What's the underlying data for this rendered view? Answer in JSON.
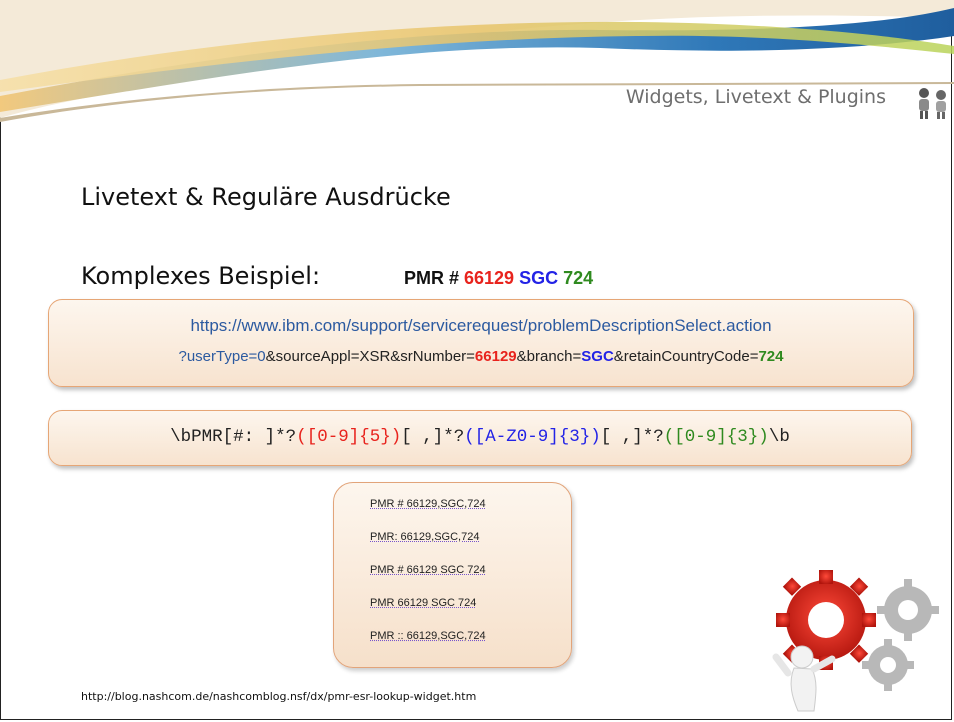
{
  "header": {
    "title": "Widgets, Livetext & Plugins",
    "icon": "people-icon"
  },
  "heading": "Livetext & Reguläre Ausdrücke",
  "subheading": "Komplexes Beispiel:",
  "pmr_example": {
    "p1": "PMR # ",
    "p2": "66129",
    "p3": " SGC",
    "p4": " 724"
  },
  "url": {
    "line1": "https://www.ibm.com/support/servicerequest/problemDescriptionSelect.action",
    "l2_a": "?userType=0",
    "l2_b": "&sourceAppl=XSR&srNumber=",
    "l2_c": "66129",
    "l2_d": "&branch=",
    "l2_e": "SGC",
    "l2_f": "&retainCountryCode=",
    "l2_g": "724"
  },
  "regex": {
    "r1": "\\bPMR[#: ]*?",
    "r2": "([0-9]{5})",
    "r3": "[ ,]*?",
    "r4": "([A-Z0-9]{3})",
    "r5": "[ ,]*?",
    "r6": "([0-9]{3})",
    "r7": "\\b"
  },
  "examples": [
    "PMR # 66129,SGC,724",
    "PMR: 66129,SGC,724",
    "PMR # 66129 SGC 724",
    "PMR 66129 SGC 724",
    "PMR :: 66129,SGC,724"
  ],
  "footer_link": "http://blog.nashcom.de/nashcomblog.nsf/dx/pmr-esr-lookup-widget.htm",
  "illustration": "gears-figure-icon",
  "colors": {
    "red": "#e8231d",
    "blue": "#2323e6",
    "green": "#2f8a1f",
    "box_border": "#e6a676"
  }
}
